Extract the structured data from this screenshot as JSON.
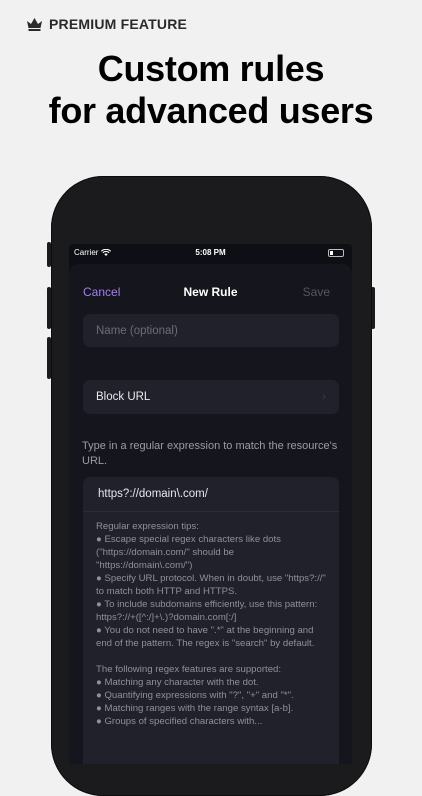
{
  "promo": {
    "badge": "PREMIUM FEATURE",
    "headline_line1": "Custom rules",
    "headline_line2": "for advanced users"
  },
  "status_bar": {
    "carrier": "Carrier",
    "time": "5:08 PM"
  },
  "nav": {
    "cancel": "Cancel",
    "title": "New Rule",
    "save": "Save"
  },
  "form": {
    "name_placeholder": "Name (optional)",
    "action_label": "Block URL",
    "help_text": "Type in a regular expression to match the resource's URL.",
    "regex_value": "https?://domain\\.com/"
  },
  "tips": {
    "heading": "Regular expression tips:",
    "items": [
      "● Escape special regex characters like dots (\"https://domain.com/\" should be \"https://domain\\.com/\")",
      "● Specify URL protocol. When in doubt, use \"https?://\" to match both HTTP and HTTPS.",
      "● To include subdomains efficiently, use this pattern: https?://+([^:/]+\\.)?domain.com[:/]",
      "● You do not need to have \".*\" at the beginning and end of the pattern. The regex is \"search\" by default."
    ],
    "supported_heading": "The following regex features are supported:",
    "supported_items": [
      "● Matching any character with the dot.",
      "● Quantifying expressions with \"?\", \"+\" and \"*\".",
      "● Matching ranges with the range syntax [a-b].",
      "● Groups of specified characters with..."
    ]
  },
  "colors": {
    "accent": "#a57cf1",
    "background": "#f1f1f2",
    "screen": "#15161d",
    "field": "#20212a"
  }
}
